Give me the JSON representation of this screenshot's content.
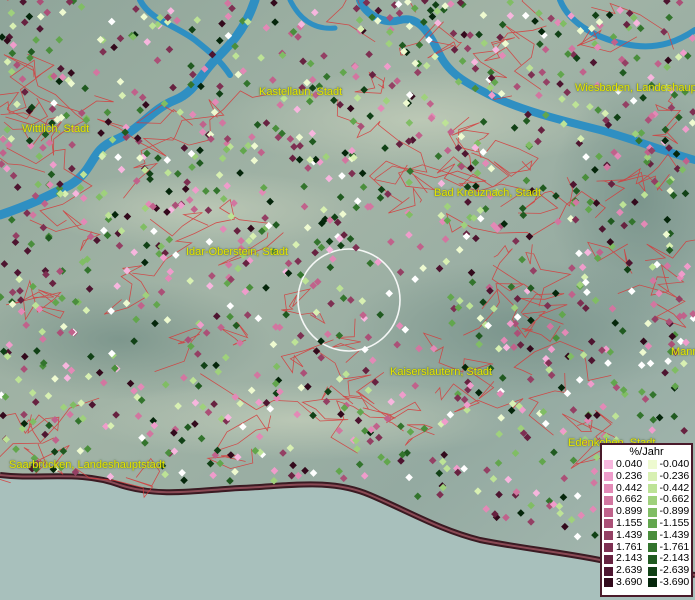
{
  "map": {
    "cities": [
      {
        "name": "Kastellaun, Stadt"
      },
      {
        "name": "Wiesbaden, Landeshauptstadt"
      },
      {
        "name": "Wittlich, Stadt"
      },
      {
        "name": "Bad Kreuznach, Stadt"
      },
      {
        "name": "Idar-Oberstein, Stadt"
      },
      {
        "name": "Kaiserslautern, Stadt"
      },
      {
        "name": "Mannheim"
      },
      {
        "name": "Edenkoben, Stadt"
      },
      {
        "name": "Saarbrücken, Landeshauptstadt"
      }
    ]
  },
  "legend": {
    "unit": "%/Jahr",
    "positive": [
      {
        "label": "0.040",
        "color": "#f7b6de"
      },
      {
        "label": "0.236",
        "color": "#ef9ccb"
      },
      {
        "label": "0.442",
        "color": "#e389b6"
      },
      {
        "label": "0.662",
        "color": "#d276a0"
      },
      {
        "label": "0.899",
        "color": "#c0628b"
      },
      {
        "label": "1.155",
        "color": "#ab5077"
      },
      {
        "label": "1.439",
        "color": "#944064"
      },
      {
        "label": "1.761",
        "color": "#7e3052"
      },
      {
        "label": "2.143",
        "color": "#672240"
      },
      {
        "label": "2.639",
        "color": "#4e1530"
      },
      {
        "label": "3.690",
        "color": "#330a1c"
      }
    ],
    "negative": [
      {
        "label": "-0.040",
        "color": "#eefad0"
      },
      {
        "label": "-0.236",
        "color": "#d8f0b2"
      },
      {
        "label": "-0.442",
        "color": "#bde396"
      },
      {
        "label": "-0.662",
        "color": "#9fd17c"
      },
      {
        "label": "-0.899",
        "color": "#80bd64"
      },
      {
        "label": "-1.155",
        "color": "#62a64d"
      },
      {
        "label": "-1.439",
        "color": "#4a8e3c"
      },
      {
        "label": "-1.761",
        "color": "#33742d"
      },
      {
        "label": "-2.143",
        "color": "#205a20"
      },
      {
        "label": "-2.639",
        "color": "#114116"
      },
      {
        "label": "-3.690",
        "color": "#05260b"
      }
    ]
  },
  "colors": {
    "river": "#2f8fc2",
    "borders": "#d63a3a",
    "label": "#e6e600",
    "point_white": "#ffffff"
  }
}
